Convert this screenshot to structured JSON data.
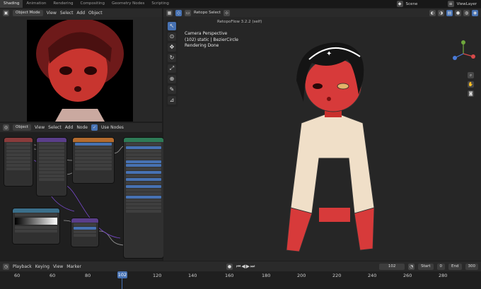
{
  "workspaces": {
    "tabs": [
      "Shading",
      "Animation",
      "Rendering",
      "Compositing",
      "Geometry Nodes",
      "Scripting"
    ],
    "scene": "Scene",
    "view_layer": "ViewLayer"
  },
  "image_editor": {
    "mode": "Object Mode",
    "menus": [
      "View",
      "Select",
      "Add",
      "Object"
    ]
  },
  "node_editor": {
    "type": "Object",
    "menus": [
      "View",
      "Select",
      "Add",
      "Node"
    ],
    "use_nodes": "Use Nodes"
  },
  "viewport": {
    "header_label": "Retopo Select",
    "overlay_lines": [
      "Camera Perspective",
      "(102) static | BezierCircle",
      "Rendering Done"
    ],
    "addon_label": "RetopoFlow 3.2.2 (self)"
  },
  "timeline": {
    "menus": [
      "Playback",
      "Keying",
      "View",
      "Marker"
    ],
    "current_frame": "102",
    "start_label": "Start",
    "start": "0",
    "end_label": "End",
    "end": "300",
    "ticks": [
      "60",
      "60",
      "80",
      "102",
      "120",
      "140",
      "160",
      "180",
      "200",
      "220",
      "240",
      "260",
      "280"
    ]
  },
  "colors": {
    "accent": "#4772b3",
    "playhead": "#4772b3"
  }
}
